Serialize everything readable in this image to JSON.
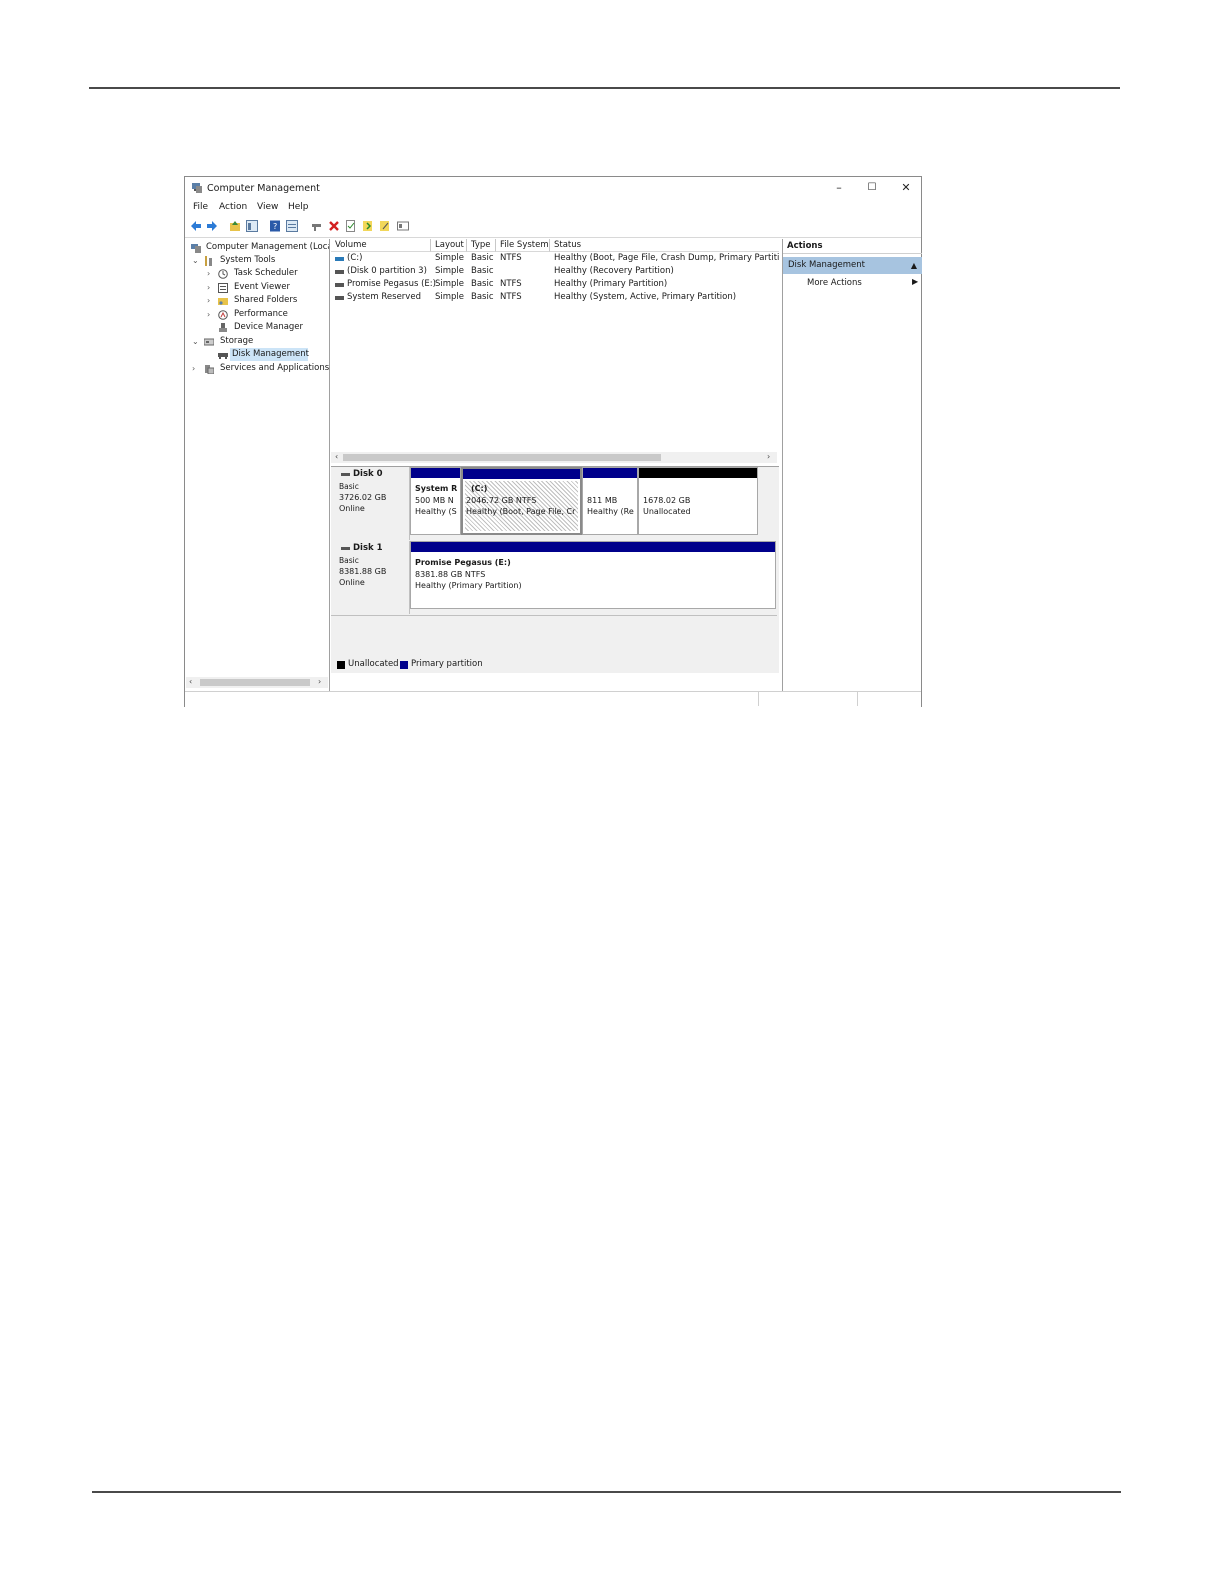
{
  "window": {
    "title": "Computer Management",
    "minimize": "–",
    "maximize": "☐",
    "close": "✕"
  },
  "menu": [
    "File",
    "Action",
    "View",
    "Help"
  ],
  "tree": [
    {
      "label": "Computer Management (Loca",
      "chevron": ""
    },
    {
      "label": "System Tools",
      "chevron": "⌄"
    },
    {
      "label": "Task Scheduler",
      "chevron": "›"
    },
    {
      "label": "Event Viewer",
      "chevron": "›"
    },
    {
      "label": "Shared Folders",
      "chevron": "›"
    },
    {
      "label": "Performance",
      "chevron": "›"
    },
    {
      "label": "Device Manager",
      "chevron": ""
    },
    {
      "label": "Storage",
      "chevron": "⌄"
    },
    {
      "label": "Disk Management",
      "chevron": ""
    },
    {
      "label": "Services and Applications",
      "chevron": "›"
    }
  ],
  "volumes": {
    "headers": [
      "Volume",
      "Layout",
      "Type",
      "File System",
      "Status"
    ],
    "rows": [
      [
        "(C:)",
        "Simple",
        "Basic",
        "NTFS",
        "Healthy (Boot, Page File, Crash Dump, Primary Partition)"
      ],
      [
        "(Disk 0 partition 3)",
        "Simple",
        "Basic",
        "",
        "Healthy (Recovery Partition)"
      ],
      [
        "Promise Pegasus (E:)",
        "Simple",
        "Basic",
        "NTFS",
        "Healthy (Primary Partition)"
      ],
      [
        "System Reserved",
        "Simple",
        "Basic",
        "NTFS",
        "Healthy (System, Active, Primary Partition)"
      ]
    ]
  },
  "disks": [
    {
      "name": "Disk 0",
      "type": "Basic",
      "size": "3726.02 GB",
      "state": "Online",
      "partitions": [
        {
          "title": "System R",
          "line2": "500 MB N",
          "line3": "Healthy (S"
        },
        {
          "title": "(C:)",
          "line2": "2046.72 GB NTFS",
          "line3": "Healthy (Boot, Page File, Cr"
        },
        {
          "title": "",
          "line2": "811 MB",
          "line3": "Healthy (Re"
        },
        {
          "title": "",
          "line2": "1678.02 GB",
          "line3": "Unallocated"
        }
      ]
    },
    {
      "name": "Disk 1",
      "type": "Basic",
      "size": "8381.88 GB",
      "state": "Online",
      "partitions": [
        {
          "title": "Promise Pegasus  (E:)",
          "line2": "8381.88 GB NTFS",
          "line3": "Healthy (Primary Partition)"
        }
      ]
    }
  ],
  "legend": {
    "unallocated": "Unallocated",
    "primary": "Primary partition"
  },
  "actions": {
    "header": "Actions",
    "selected": "Disk Management",
    "more": "More Actions"
  },
  "colors": {
    "primary": "#00008b",
    "unallocated": "#000000",
    "selection": "#a7c4e0"
  }
}
